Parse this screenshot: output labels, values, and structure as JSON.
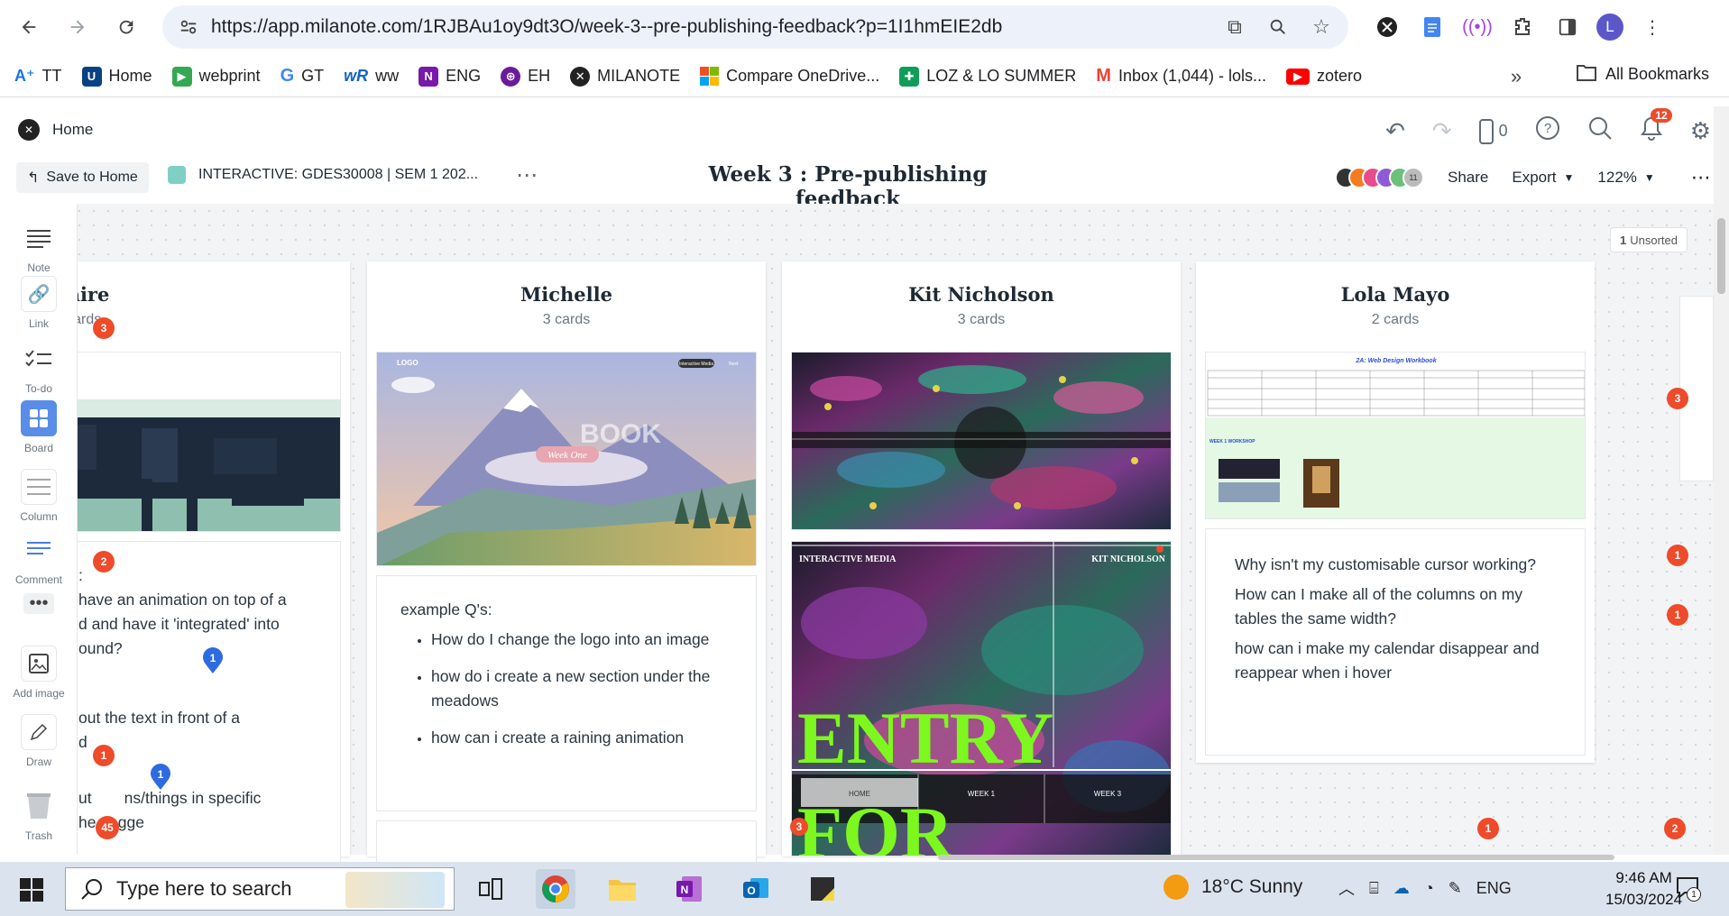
{
  "browser": {
    "url": "https://app.milanote.com/1RJBAu1oy9dt3O/week-3--pre-publishing-feedback?p=1I1hmEIE2db",
    "profile_initial": "L",
    "bookmarks": [
      {
        "label": "TT",
        "icon": "text-size-icon",
        "color": "#1a73e8"
      },
      {
        "label": "Home",
        "icon": "unimelb-icon",
        "color": "#094183"
      },
      {
        "label": "webprint",
        "icon": "chat-icon",
        "color": "#34a853"
      },
      {
        "label": "GT",
        "icon": "google-icon",
        "color": "#4285f4"
      },
      {
        "label": "ww",
        "icon": "wr-icon",
        "color": "#1565c0"
      },
      {
        "label": "ENG",
        "icon": "onenote-icon",
        "color": "#7719aa"
      },
      {
        "label": "EH",
        "icon": "eh-icon",
        "color": "#6a1b9a"
      },
      {
        "label": "MILANOTE",
        "icon": "milanote-icon",
        "color": "#222222"
      },
      {
        "label": "Compare OneDrive...",
        "icon": "microsoft-icon",
        "color": "#f25022"
      },
      {
        "label": "LOZ & LO SUMMER",
        "icon": "sheets-icon",
        "color": "#0f9d58"
      },
      {
        "label": "Inbox (1,044) - lols...",
        "icon": "gmail-icon",
        "color": "#ea4335"
      },
      {
        "label": "zotero",
        "icon": "youtube-icon",
        "color": "#ff0000"
      }
    ],
    "all_bookmarks": "All Bookmarks"
  },
  "app": {
    "home_label": "Home",
    "save_to_home": "Save to Home",
    "board_crumb": "INTERACTIVE: GDES30008 | SEM 1 202...",
    "board_title": "Week 3 : Pre-publishing feedback",
    "mobile_count": "0",
    "notifications": "12",
    "share": "Share",
    "export": "Export",
    "zoom": "122%",
    "viewer_count": "11",
    "unsorted": "Unsorted",
    "unsorted_count": "1"
  },
  "toolbar": [
    {
      "label": "Note",
      "icon": "note-icon"
    },
    {
      "label": "Link",
      "icon": "link-icon"
    },
    {
      "label": "To-do",
      "icon": "todo-icon"
    },
    {
      "label": "Board",
      "icon": "board-icon"
    },
    {
      "label": "Column",
      "icon": "column-icon"
    },
    {
      "label": "Comment",
      "icon": "comment-icon"
    },
    {
      "label": "Add image",
      "icon": "image-icon"
    },
    {
      "label": "Draw",
      "icon": "pen-icon"
    },
    {
      "label": "Trash",
      "icon": "trash-icon"
    }
  ],
  "columns": [
    {
      "title": "Claire",
      "count": "2 cards",
      "note_lines": [
        ":",
        "have an animation on top of a",
        "d and have it 'integrated' into",
        "ound?",
        "out the text in front of a",
        "d",
        "ut",
        "ns/things in specific",
        "he pagge"
      ]
    },
    {
      "title": "Michelle",
      "count": "3 cards",
      "image": {
        "logo": "LOGO",
        "nav1": "Interactive Media",
        "nav2": "Next",
        "book": "BOOK",
        "week": "Week One"
      },
      "note_heading": "example Q's:",
      "bullets": [
        "How do I change the logo into an image",
        "how do i create a new section under the meadows",
        "how can i create a raining animation"
      ]
    },
    {
      "title": "Kit Nicholson",
      "count": "3 cards",
      "image2": {
        "left": "INTERACTIVE MEDIA",
        "right": "KIT NICHOLSON",
        "big1": "ENTRY",
        "big2": "FOR",
        "nav_home": "HOME",
        "nav_w1": "WEEK 1",
        "nav_w3": "WEEK 3"
      }
    },
    {
      "title": "Lola Mayo",
      "count": "2 cards",
      "sheet_title": "2A: Web Design Workbook",
      "sheet_section": "WEEK 1 WORKSHOP",
      "questions": [
        "Why isn't my customisable cursor working?",
        "How can I make all of the columns on my tables the same width?",
        "how can i make my calendar disappear and reappear when i hover"
      ]
    }
  ],
  "badges": [
    "3",
    "2",
    "1",
    "45",
    "3",
    "1",
    "1",
    "1",
    "2",
    "3"
  ],
  "pins": [
    "1",
    "1"
  ],
  "taskbar": {
    "search_placeholder": "Type here to search",
    "weather": "18°C  Sunny",
    "lang": "ENG",
    "time": "9:46 AM",
    "date": "15/03/2024",
    "notification_count": "1"
  }
}
